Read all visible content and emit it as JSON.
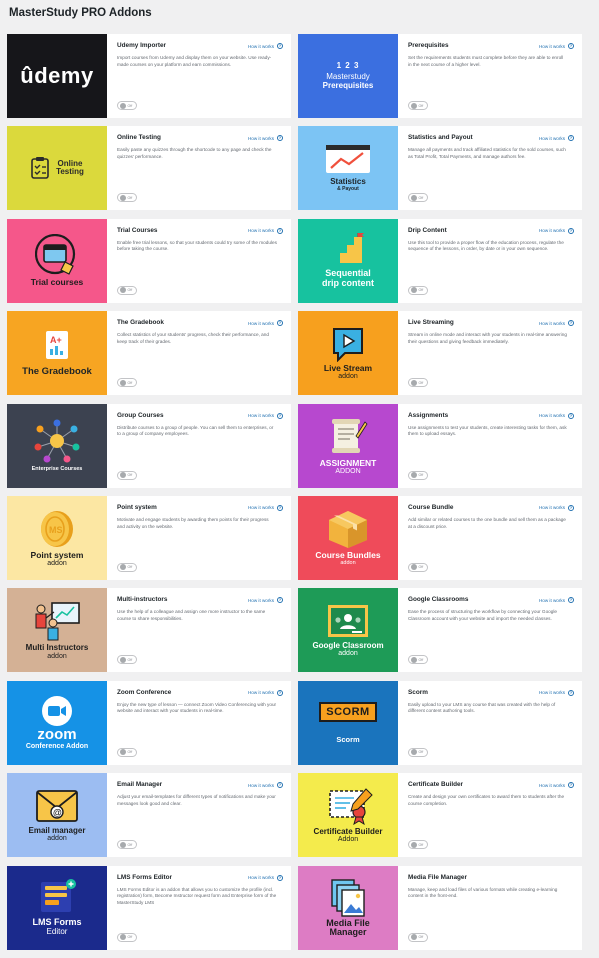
{
  "page": {
    "title": "MasterStudy PRO Addons"
  },
  "common": {
    "how_label": "How it works",
    "toggle_label": "Off"
  },
  "addons": [
    {
      "key": "udemy",
      "title": "Udemy Importer",
      "description": "Import courses from Udemy and display them on your website. Use ready-made courses on your platform and earn commissions.",
      "has_how": true,
      "thumb": {
        "bg": "#16161a",
        "line1": "ûdemy",
        "line2": "",
        "line3": ""
      }
    },
    {
      "key": "prerequisites",
      "title": "Prerequisites",
      "description": "Set the requirements students must complete before they are able to enroll in the next course of a higher level.",
      "has_how": true,
      "thumb": {
        "bg": "#3b6fe0",
        "line1": "1 2 3",
        "line2": "Masterstudy",
        "line3": "Prerequisites"
      }
    },
    {
      "key": "online-testing",
      "title": "Online Testing",
      "description": "Easily paste any quizzes through the shortcode to any page and check the quizzes' performance.",
      "has_how": true,
      "thumb": {
        "bg": "#dbd93c",
        "line1": "Online",
        "line2": "Testing",
        "line3": ""
      }
    },
    {
      "key": "statistics",
      "title": "Statistics and Payout",
      "description": "Manage all payments and track affiliated statistics for the sold courses, such as Total Profit, Total Payments, and manage authors fee.",
      "has_how": true,
      "thumb": {
        "bg": "#7cc4f4",
        "line1": "Statistics",
        "line2": "& Payout",
        "line3": ""
      }
    },
    {
      "key": "trial-courses",
      "title": "Trial Courses",
      "description": "Enable free trial lessons, so that your students could try some of the modules before taking the course.",
      "has_how": true,
      "thumb": {
        "bg": "#f5578a",
        "line1": "Trial courses",
        "line2": "",
        "line3": ""
      }
    },
    {
      "key": "drip-content",
      "title": "Drip Content",
      "description": "Use this tool to provide a proper flow of the education process, regulate the sequence of the lessons, in order, by date or in your own sequence.",
      "has_how": true,
      "thumb": {
        "bg": "#17c29f",
        "line1": "Sequential",
        "line2": "drip content",
        "line3": ""
      }
    },
    {
      "key": "gradebook",
      "title": "The Gradebook",
      "description": "Collect statistics of your students' progress, check their performance, and keep track of their grades.",
      "has_how": true,
      "thumb": {
        "bg": "#f7a522",
        "line1": "The Gradebook",
        "line2": "",
        "line3": ""
      }
    },
    {
      "key": "live-streaming",
      "title": "Live Streaming",
      "description": "Stream in online mode and interact with your students in real-time answering their questions and giving feedback immediately.",
      "has_how": true,
      "thumb": {
        "bg": "#f7a01e",
        "line1": "Live Stream",
        "line2": "addon",
        "line3": ""
      }
    },
    {
      "key": "group-courses",
      "title": "Group Courses",
      "description": "Distribute courses to a group of people. You can sell them to enterprises, or to a group of company employees.",
      "has_how": true,
      "thumb": {
        "bg": "#3c4250",
        "line1": "Enterprise Courses",
        "line2": "",
        "line3": ""
      }
    },
    {
      "key": "assignments",
      "title": "Assignments",
      "description": "Use assignments to test your students, create interesting tasks for them, ask them to upload essays.",
      "has_how": true,
      "thumb": {
        "bg": "#b748cf",
        "line1": "ASSIGNMENT",
        "line2": "ADDON",
        "line3": ""
      }
    },
    {
      "key": "point-system",
      "title": "Point system",
      "description": "Motivate and engage students by awarding them points for their progress and activity on the website.",
      "has_how": true,
      "thumb": {
        "bg": "#fce7a3",
        "line1": "Point system",
        "line2": "addon",
        "line3": ""
      }
    },
    {
      "key": "course-bundle",
      "title": "Course Bundle",
      "description": "Add similar or related courses to the one bundle and sell them as a package at a discount price.",
      "has_how": true,
      "thumb": {
        "bg": "#ef4b5a",
        "line1": "Course Bundles",
        "line2": "addon",
        "line3": ""
      }
    },
    {
      "key": "multi-instructors",
      "title": "Multi-instructors",
      "description": "Use the help of a colleague and assign one more instructor to the same course to share responsibilities.",
      "has_how": true,
      "thumb": {
        "bg": "#d4b195",
        "line1": "Multi Instructors",
        "line2": "addon",
        "line3": ""
      }
    },
    {
      "key": "google-classrooms",
      "title": "Google Classrooms",
      "description": "Ease the process of structuring the workflow by connecting your Google Classroom account with your website and import the needed classes.",
      "has_how": true,
      "thumb": {
        "bg": "#1e9b57",
        "line1": "Google Classroom",
        "line2": "addon",
        "line3": ""
      }
    },
    {
      "key": "zoom",
      "title": "Zoom Conference",
      "description": "Enjoy the new type of lesson — connect Zoom Video Conferencing with your website and interact with your students in real-time.",
      "has_how": true,
      "thumb": {
        "bg": "#1592e6",
        "line1": "zoom",
        "line2": "Conference Addon",
        "line3": ""
      }
    },
    {
      "key": "scorm",
      "title": "Scorm",
      "description": "Easily upload to your LMS any course that was created with the help of different content authoring tools.",
      "has_how": true,
      "thumb": {
        "bg": "#1a74bd",
        "line1": "SCORM",
        "line2": "Scorm",
        "line3": ""
      }
    },
    {
      "key": "email-manager",
      "title": "Email Manager",
      "description": "Adjust your email-templates for different types of notifications and make your messages look good and clear.",
      "has_how": true,
      "thumb": {
        "bg": "#9cbdf2",
        "line1": "Email manager",
        "line2": "addon",
        "line3": ""
      }
    },
    {
      "key": "certificate-builder",
      "title": "Certificate Builder",
      "description": "Create and design your own certificates to award them to students after the course completion.",
      "has_how": true,
      "thumb": {
        "bg": "#f4eb4c",
        "line1": "Certificate Builder",
        "line2": "Addon",
        "line3": ""
      }
    },
    {
      "key": "lms-forms",
      "title": "LMS Forms Editor",
      "description": "LMS Forms Editor is an addon that allows you to customize the profile (incl. registration) form, Become Instructor request form and Enterprise form of the MasterStudy LMS",
      "has_how": true,
      "thumb": {
        "bg": "#1b2a8c",
        "line1": "LMS Forms",
        "line2": "Editor",
        "line3": ""
      }
    },
    {
      "key": "media-file-manager",
      "title": "Media File Manager",
      "description": "Manage, keep and load files of various formats while creating e-learning content in the front-end.",
      "has_how": false,
      "thumb": {
        "bg": "#dd7cc4",
        "line1": "Media File",
        "line2": "Manager",
        "line3": ""
      }
    }
  ]
}
